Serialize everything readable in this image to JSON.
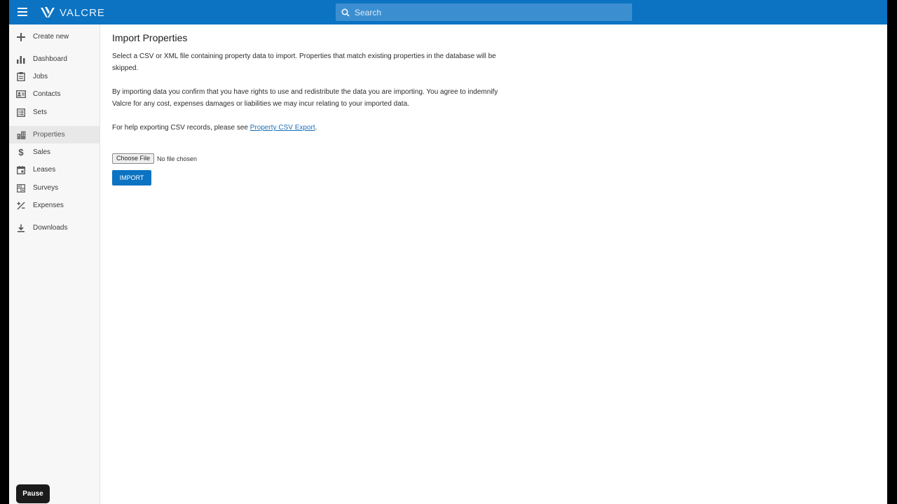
{
  "header": {
    "logo_text": "VALCRE",
    "search_placeholder": "Search",
    "menu_icon": "hamburger-icon",
    "search_icon": "search-icon",
    "brand_color": "#0b73c2"
  },
  "sidebar": {
    "items": [
      {
        "label": "Create new",
        "icon": "plus-icon"
      },
      {
        "label": "Dashboard",
        "icon": "bar-chart-icon"
      },
      {
        "label": "Jobs",
        "icon": "clipboard-icon"
      },
      {
        "label": "Contacts",
        "icon": "contact-card-icon"
      },
      {
        "label": "Sets",
        "icon": "list-grid-icon"
      },
      {
        "label": "Properties",
        "icon": "buildings-icon",
        "active": true
      },
      {
        "label": "Sales",
        "icon": "dollar-icon"
      },
      {
        "label": "Leases",
        "icon": "calendar-icon"
      },
      {
        "label": "Surveys",
        "icon": "survey-grid-icon"
      },
      {
        "label": "Expenses",
        "icon": "percent-icon"
      },
      {
        "label": "Downloads",
        "icon": "download-icon"
      }
    ]
  },
  "main": {
    "title": "Import Properties",
    "para1": "Select a CSV or XML file containing property data to import. Properties that match existing properties in the database will be skipped.",
    "para2": "By importing data you confirm that you have rights to use and redistribute the data you are importing. You agree to indemnify Valcre for any cost, expenses damages or liabilities we may incur relating to your imported data.",
    "para3_prefix": "For help exporting CSV records, please see ",
    "para3_link": "Property CSV Export",
    "para3_suffix": ".",
    "file_button": "Choose File",
    "file_status": "No file chosen",
    "import_button": "IMPORT"
  },
  "overlay": {
    "pause_button": "Pause"
  }
}
